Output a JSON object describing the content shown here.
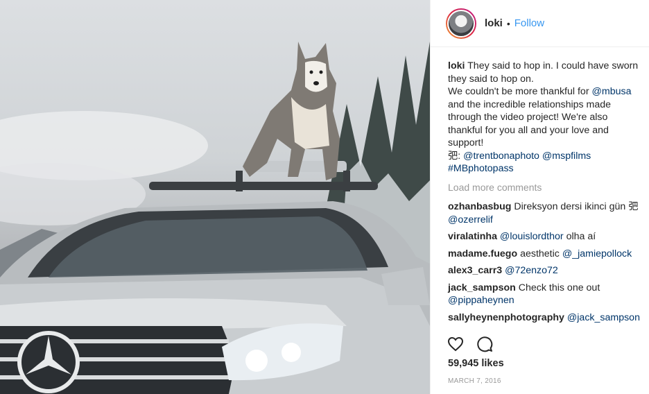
{
  "photo": {
    "alt_icon": "husky-on-car-photo"
  },
  "header": {
    "username": "loki",
    "separator": "•",
    "follow_label": "Follow"
  },
  "caption": {
    "user": "loki",
    "lines": [
      "They said to hop in. I could have sworn",
      "they said to hop on.",
      "We couldn't be more thankful for ",
      "and the incredible relationships made",
      "through the video project! We're also",
      "thankful for you all and your love and",
      "support!"
    ],
    "mention_mbusa": "@mbusa",
    "credit_prefix": "弝: ",
    "mention_trent": "@trentbonaphoto",
    "mention_msp": "@mspfilms",
    "hashtag": "#MBphotopass"
  },
  "load_more": "Load more comments",
  "comments": [
    {
      "user": "ozhanbasbug",
      "text": "Direksyon dersi ikinci gün 弝",
      "mention": "@ozerrelif"
    },
    {
      "user": "viralatinha",
      "mention": "@louislordthor",
      "text": "olha aí"
    },
    {
      "user": "madame.fuego",
      "text": "aesthetic",
      "mention": "@_jamiepollock"
    },
    {
      "user": "alex3_carr3",
      "mention": "@72enzo72"
    },
    {
      "user": "jack_sampson",
      "text": "Check this one out",
      "mention": "@pippaheynen"
    },
    {
      "user": "sallyheynenphotography",
      "mention": "@jack_sampson"
    }
  ],
  "likes": "59,945 likes",
  "date": "MARCH 7, 2016",
  "icons": {
    "like": "heart-icon",
    "comment": "comment-icon"
  }
}
